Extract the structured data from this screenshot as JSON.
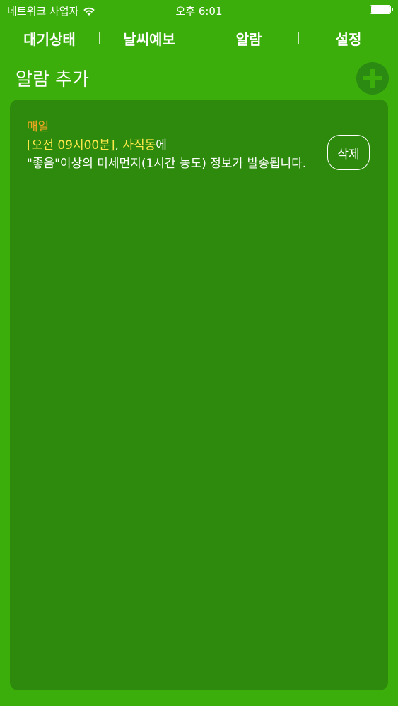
{
  "status_bar": {
    "carrier": "네트워크 사업자",
    "wifi_icon": "wifi-icon",
    "time": "오후 6:01",
    "battery_icon": "battery-icon",
    "battery_level": 1.0
  },
  "tabs": [
    {
      "label": "대기상태"
    },
    {
      "label": "날씨예보"
    },
    {
      "label": "알람"
    },
    {
      "label": "설정"
    }
  ],
  "header": {
    "title": "알람 추가",
    "add_icon": "plus-icon"
  },
  "colors": {
    "background": "#3cae0c",
    "panel": "#2d8a0c",
    "repeat_text": "#f5a623",
    "highlight_text": "#ffe94a",
    "text": "#ffffff"
  },
  "alarms": [
    {
      "repeat": "매일",
      "time": "[오전 09시00분]",
      "separator": ", ",
      "place": "사직동",
      "place_suffix": "에",
      "message": "\"좋음\"이상의 미세먼지(1시간 농도) 정보가 발송됩니다.",
      "delete_label": "삭제"
    }
  ]
}
